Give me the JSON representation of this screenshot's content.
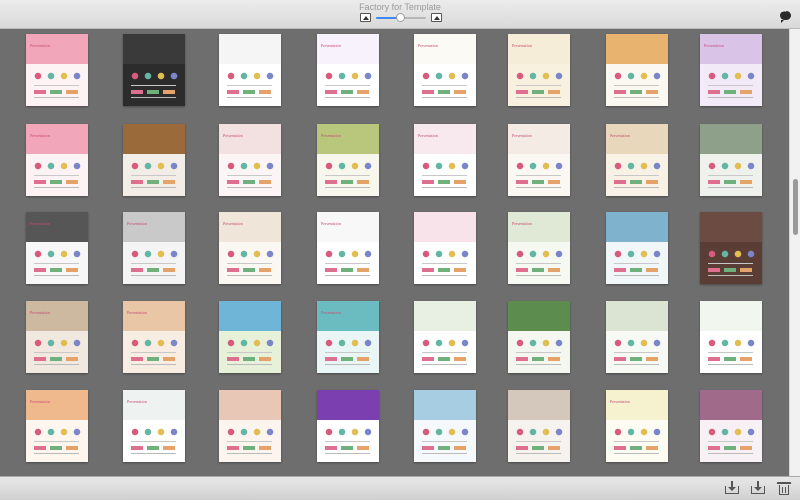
{
  "window": {
    "title": "Factory for Template"
  },
  "toolbar": {
    "zoom_level": 0.48
  },
  "icons": {
    "zoom_small": "image-small-icon",
    "zoom_large": "image-large-icon",
    "chat": "chat-bubble-icon",
    "import": "import-tray-icon",
    "export": "save-tray-icon",
    "delete": "trash-icon"
  },
  "templates": [
    {
      "cover": "#f1a7b9",
      "panel": "#fdf2f4",
      "title": "Presentation"
    },
    {
      "cover": "#3a3a3a",
      "panel": "#2c2c2c",
      "title": ""
    },
    {
      "cover": "#f5f5f5",
      "panel": "#ffffff",
      "title": ""
    },
    {
      "cover": "#f7f2fb",
      "panel": "#ffffff",
      "title": "Presentation"
    },
    {
      "cover": "#fbfaf5",
      "panel": "#ffffff",
      "title": "Presentation"
    },
    {
      "cover": "#f5edd8",
      "panel": "#f8f1e0",
      "title": "Presentation"
    },
    {
      "cover": "#e8b36e",
      "panel": "#fbf8f1",
      "title": ""
    },
    {
      "cover": "#d9c4e8",
      "panel": "#f2ebf7",
      "title": "Presentation"
    },
    {
      "cover": "#f1a7b9",
      "panel": "#fdf2f4",
      "title": "Presentation"
    },
    {
      "cover": "#9a6a3a",
      "panel": "#f2ede6",
      "title": ""
    },
    {
      "cover": "#f3e0e0",
      "panel": "#fbf5f5",
      "title": "Presentation"
    },
    {
      "cover": "#b9c77d",
      "panel": "#f8f7ee",
      "title": "Presentation"
    },
    {
      "cover": "#f8e9ee",
      "panel": "#ffffff",
      "title": "Presentation"
    },
    {
      "cover": "#f3ebe4",
      "panel": "#fbf7f3",
      "title": "Presentation"
    },
    {
      "cover": "#e8d7ba",
      "panel": "#f8f1e6",
      "title": "Presentation"
    },
    {
      "cover": "#8fa08a",
      "panel": "#eef1ec",
      "title": ""
    },
    {
      "cover": "#565656",
      "panel": "#f7f7f7",
      "title": "Presentation"
    },
    {
      "cover": "#c9c9c9",
      "panel": "#f4f4f4",
      "title": "Presentation"
    },
    {
      "cover": "#efe5d8",
      "panel": "#fbf7f2",
      "title": "Presentation"
    },
    {
      "cover": "#f8f8f8",
      "panel": "#ffffff",
      "title": "Presentation"
    },
    {
      "cover": "#f9e3ea",
      "panel": "#ffffff",
      "title": ""
    },
    {
      "cover": "#dfe9d5",
      "panel": "#f6f8f2",
      "title": "Presentation"
    },
    {
      "cover": "#7fb2cc",
      "panel": "#f1f6f8",
      "title": ""
    },
    {
      "cover": "#6b4b42",
      "panel": "#5a3e36",
      "title": ""
    },
    {
      "cover": "#cdb8a0",
      "panel": "#f1e9df",
      "title": "Presentation"
    },
    {
      "cover": "#e9c6a5",
      "panel": "#f8ede2",
      "title": "Presentation"
    },
    {
      "cover": "#6fb5d8",
      "panel": "#e7f1d9",
      "title": ""
    },
    {
      "cover": "#6bbcc0",
      "panel": "#eaf6f6",
      "title": "Presentation"
    },
    {
      "cover": "#e7f0e2",
      "panel": "#ffffff",
      "title": ""
    },
    {
      "cover": "#5d8d4e",
      "panel": "#f3f7ef",
      "title": ""
    },
    {
      "cover": "#dbe3d3",
      "panel": "#f7f9f4",
      "title": ""
    },
    {
      "cover": "#f1f6ee",
      "panel": "#ffffff",
      "title": ""
    },
    {
      "cover": "#f0b98d",
      "panel": "#fdf6ef",
      "title": "Presentation"
    },
    {
      "cover": "#eef3f2",
      "panel": "#ffffff",
      "title": "Presentation"
    },
    {
      "cover": "#e9c7b6",
      "panel": "#fbf4ef",
      "title": ""
    },
    {
      "cover": "#7c3fb0",
      "panel": "#ffffff",
      "title": ""
    },
    {
      "cover": "#a7cde3",
      "panel": "#f5f9fc",
      "title": ""
    },
    {
      "cover": "#d4c7bb",
      "panel": "#f6f2ee",
      "title": ""
    },
    {
      "cover": "#f6f2cf",
      "panel": "#fdfcf3",
      "title": "Presentation"
    },
    {
      "cover": "#a06b8a",
      "panel": "#f7f0f4",
      "title": ""
    }
  ]
}
